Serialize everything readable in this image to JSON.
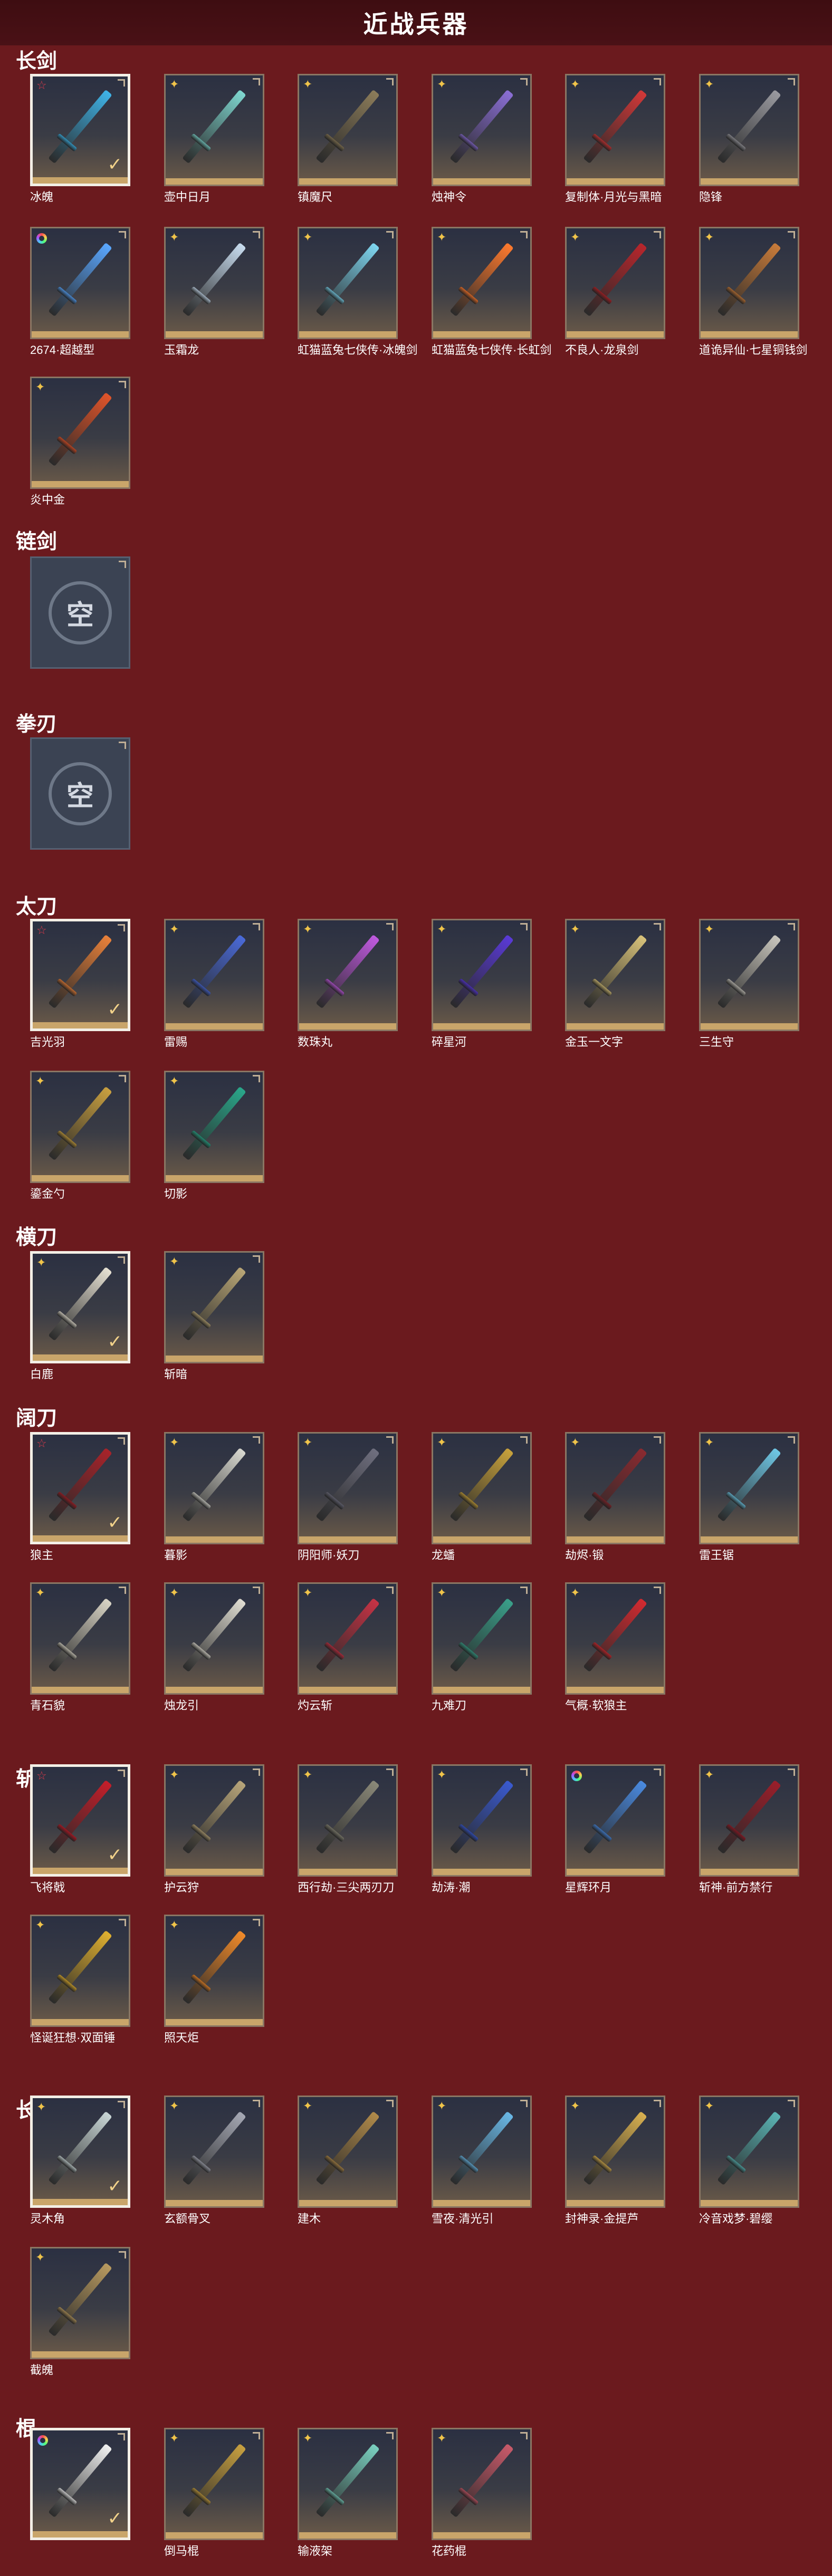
{
  "page_title": "近战兵器",
  "empty_text": "空",
  "categories": [
    {
      "name": "长剑",
      "items": [
        {
          "label": "冰魄",
          "rank": "red",
          "selected": true,
          "color": "#3fb4e8"
        },
        {
          "label": "壶中日月",
          "rank": "gold",
          "selected": false,
          "color": "#7fd7d0"
        },
        {
          "label": "镇魔尺",
          "rank": "gold",
          "selected": false,
          "color": "#8c7c5a"
        },
        {
          "label": "烛神令",
          "rank": "gold",
          "selected": false,
          "color": "#8b6fd6"
        },
        {
          "label": "复制体·月光与黑暗",
          "rank": "gold",
          "selected": false,
          "color": "#d23838"
        },
        {
          "label": "隐锋",
          "rank": "gold",
          "selected": false,
          "color": "#9a9aa0"
        },
        {
          "label": "2674·超越型",
          "rank": "rainbow",
          "selected": false,
          "color": "#5aa7ff"
        },
        {
          "label": "玉霜龙",
          "rank": "gold",
          "selected": false,
          "color": "#c8dcef"
        },
        {
          "label": "虹猫蓝兔七侠传·冰魄剑",
          "rank": "gold",
          "selected": false,
          "color": "#7ed6f0"
        },
        {
          "label": "虹猫蓝兔七侠传·长虹剑",
          "rank": "gold",
          "selected": false,
          "color": "#ff7a2e"
        },
        {
          "label": "不良人·龙泉剑",
          "rank": "gold",
          "selected": false,
          "color": "#b8262c"
        },
        {
          "label": "道诡异仙·七星铜钱剑",
          "rank": "gold",
          "selected": false,
          "color": "#c87b3a"
        },
        {
          "label": "炎中金",
          "rank": "gold",
          "selected": false,
          "color": "#e0542a"
        }
      ]
    },
    {
      "name": "链剑",
      "items": [],
      "empty": true
    },
    {
      "name": "拳刃",
      "items": [],
      "empty": true
    },
    {
      "name": "太刀",
      "items": [
        {
          "label": "吉光羽",
          "rank": "red",
          "selected": true,
          "color": "#e9813a"
        },
        {
          "label": "雷赐",
          "rank": "gold",
          "selected": false,
          "color": "#4a6ad8"
        },
        {
          "label": "数珠丸",
          "rank": "gold",
          "selected": false,
          "color": "#c05ae0"
        },
        {
          "label": "碎星河",
          "rank": "gold",
          "selected": false,
          "color": "#5a3ad8"
        },
        {
          "label": "金玉一文字",
          "rank": "gold",
          "selected": false,
          "color": "#d8c27a"
        },
        {
          "label": "三生守",
          "rank": "gold",
          "selected": false,
          "color": "#c9c6bd"
        },
        {
          "label": "鎏金勺",
          "rank": "gold",
          "selected": false,
          "color": "#c9a040"
        },
        {
          "label": "切影",
          "rank": "gold",
          "selected": false,
          "color": "#2aa78a"
        }
      ]
    },
    {
      "name": "横刀",
      "items": [
        {
          "label": "白鹿",
          "rank": "gold",
          "selected": true,
          "color": "#e6e1d3"
        },
        {
          "label": "斩暗",
          "rank": "gold",
          "selected": false,
          "color": "#b9a676"
        }
      ]
    },
    {
      "name": "阔刀",
      "items": [
        {
          "label": "狼主",
          "rank": "red",
          "selected": true,
          "color": "#a8232a"
        },
        {
          "label": "暮影",
          "rank": "gold",
          "selected": false,
          "color": "#d8d8d0"
        },
        {
          "label": "阴阳师·妖刀",
          "rank": "gold",
          "selected": false,
          "color": "#6f6f7f"
        },
        {
          "label": "龙蟠",
          "rank": "gold",
          "selected": false,
          "color": "#c8a23c"
        },
        {
          "label": "劫烬·锻",
          "rank": "gold",
          "selected": false,
          "color": "#8a2a30"
        },
        {
          "label": "雷王锯",
          "rank": "gold",
          "selected": false,
          "color": "#6fc8e6"
        },
        {
          "label": "青石貌",
          "rank": "gold",
          "selected": false,
          "color": "#d9d4c5"
        },
        {
          "label": "烛龙引",
          "rank": "gold",
          "selected": false,
          "color": "#e0ddd2"
        },
        {
          "label": "灼云斩",
          "rank": "gold",
          "selected": false,
          "color": "#c73345"
        },
        {
          "label": "九难刀",
          "rank": "gold",
          "selected": false,
          "color": "#3aa08a"
        },
        {
          "label": "气概·软狼主",
          "rank": "gold",
          "selected": false,
          "color": "#d22a30"
        }
      ]
    },
    {
      "name": "斩马刀",
      "items": [
        {
          "label": "飞将戟",
          "rank": "red",
          "selected": true,
          "color": "#c41e2a"
        },
        {
          "label": "护云狩",
          "rank": "gold",
          "selected": false,
          "color": "#b8a57a"
        },
        {
          "label": "西行劫·三尖两刃刀",
          "rank": "gold",
          "selected": false,
          "color": "#8a8878"
        },
        {
          "label": "劫涛·潮",
          "rank": "gold",
          "selected": false,
          "color": "#3a5ad0"
        },
        {
          "label": "星辉环月",
          "rank": "rainbow",
          "selected": false,
          "color": "#4a8ae0"
        },
        {
          "label": "斩神·前方禁行",
          "rank": "gold",
          "selected": false,
          "color": "#9a1e2a"
        },
        {
          "label": "怪诞狂想·双面锤",
          "rank": "gold",
          "selected": false,
          "color": "#e0b030"
        },
        {
          "label": "照天炬",
          "rank": "gold",
          "selected": false,
          "color": "#f08a2a"
        }
      ]
    },
    {
      "name": "长枪",
      "items": [
        {
          "label": "灵木角",
          "rank": "gold",
          "selected": true,
          "color": "#c9d6d6"
        },
        {
          "label": "玄额骨叉",
          "rank": "gold",
          "selected": false,
          "color": "#a5a8b4"
        },
        {
          "label": "建木",
          "rank": "gold",
          "selected": false,
          "color": "#b08a4a"
        },
        {
          "label": "雪夜·清光引",
          "rank": "gold",
          "selected": false,
          "color": "#6ab8e6"
        },
        {
          "label": "封神录·金提芦",
          "rank": "gold",
          "selected": false,
          "color": "#d8b050"
        },
        {
          "label": "冷音戏梦·碧缨",
          "rank": "gold",
          "selected": false,
          "color": "#5ab4b4"
        },
        {
          "label": "截魄",
          "rank": "gold",
          "selected": false,
          "color": "#b89a60"
        }
      ]
    },
    {
      "name": "棍",
      "items": [
        {
          "label": "",
          "rank": "rainbow",
          "selected": true,
          "color": "#f2f2f2"
        },
        {
          "label": "倒马棍",
          "rank": "gold",
          "selected": false,
          "color": "#c7a040"
        },
        {
          "label": "输液架",
          "rank": "gold",
          "selected": false,
          "color": "#7ad0c0"
        },
        {
          "label": "花药棍",
          "rank": "gold",
          "selected": false,
          "color": "#c95a6a"
        }
      ]
    }
  ]
}
